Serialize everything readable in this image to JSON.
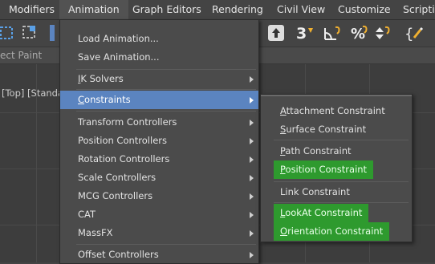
{
  "menubar": {
    "items": [
      {
        "label": "Modifiers"
      },
      {
        "label": "Animation"
      },
      {
        "label": "Graph Editors"
      },
      {
        "label": "Rendering"
      },
      {
        "label": "Civil View"
      },
      {
        "label": "Customize"
      },
      {
        "label": "Scripting"
      }
    ]
  },
  "toolbar": {
    "ribbon_label": "ect Paint",
    "icons": [
      "select-region-icon",
      "selection-filter-icon",
      "snap-3d-icon",
      "angle-snap-icon",
      "percent-snap-icon",
      "spinner-snap-icon",
      "edit-named-selections-icon"
    ]
  },
  "viewport": {
    "label": "[Top] [Standa"
  },
  "animation_menu": {
    "items": [
      {
        "label": "Load Animation...",
        "has_submenu": false
      },
      {
        "label": "Save Animation...",
        "has_submenu": false
      },
      {
        "label": "IK Solvers",
        "underline": "I",
        "rest": "K Solvers",
        "has_submenu": true
      },
      {
        "label": "Constraints",
        "underline": "C",
        "rest": "onstraints",
        "has_submenu": true,
        "highlighted": true
      },
      {
        "label": "Transform Controllers",
        "has_submenu": true
      },
      {
        "label": "Position Controllers",
        "has_submenu": true
      },
      {
        "label": "Rotation Controllers",
        "has_submenu": true
      },
      {
        "label": "Scale Controllers",
        "has_submenu": true
      },
      {
        "label": "MCG Controllers",
        "has_submenu": true
      },
      {
        "label": "CAT",
        "has_submenu": true
      },
      {
        "label": "MassFX",
        "has_submenu": true
      },
      {
        "label": "Offset Controllers",
        "has_submenu": true
      }
    ]
  },
  "constraints_menu": {
    "items": [
      {
        "label": "Attachment Constraint",
        "underline": "A",
        "rest": "ttachment Constraint",
        "highlight": false
      },
      {
        "label": "Surface Constraint",
        "underline": "S",
        "rest": "urface Constraint",
        "highlight": false
      },
      {
        "label": "Path Constraint",
        "underline": "P",
        "rest": "ath Constraint",
        "highlight": false
      },
      {
        "label": "Position Constraint",
        "underline": "P",
        "rest": "osition Constraint",
        "highlight": true
      },
      {
        "label": "Link Constraint",
        "highlight": false
      },
      {
        "label": "LookAt Constraint",
        "underline": "L",
        "rest": "ookAt Constraint",
        "highlight": true
      },
      {
        "label": "Orientation Constraint",
        "underline": "O",
        "rest": "rientation Constraint",
        "highlight": true
      }
    ]
  },
  "colors": {
    "menu_bg": "#4b4b4b",
    "menu_highlight": "#5b84c0",
    "green_highlight": "#2e9a2e",
    "app_bg": "#444444"
  }
}
